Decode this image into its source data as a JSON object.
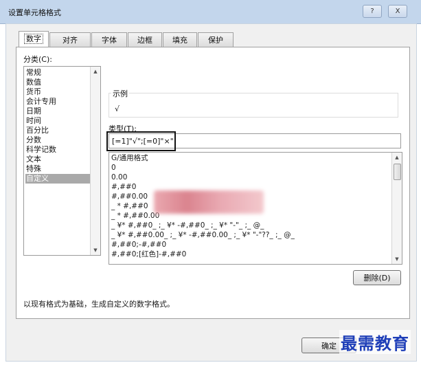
{
  "window": {
    "title": "设置单元格格式",
    "help_btn": "?",
    "close_btn": "X"
  },
  "tabs": [
    {
      "label": "数字",
      "active": true
    },
    {
      "label": "对齐",
      "active": false
    },
    {
      "label": "字体",
      "active": false
    },
    {
      "label": "边框",
      "active": false
    },
    {
      "label": "填充",
      "active": false
    },
    {
      "label": "保护",
      "active": false
    }
  ],
  "category": {
    "label": "分类(C):",
    "items": [
      "常规",
      "数值",
      "货币",
      "会计专用",
      "日期",
      "时间",
      "百分比",
      "分数",
      "科学记数",
      "文本",
      "特殊",
      "自定义"
    ],
    "selected": "自定义"
  },
  "sample": {
    "label": "示例",
    "value": "√"
  },
  "type": {
    "label": "类型(T):",
    "value": "[=1]\"√\";[=0]\"×\"",
    "formats": [
      "G/通用格式",
      "0",
      "0.00",
      "#,##0",
      "#,##0.00",
      "_ * #,##0",
      "_ * #,##0.00",
      "_ ¥* #,##0_ ;_ ¥* -#,##0_ ;_ ¥* \"-\"_ ;_ @_",
      "_ ¥* #,##0.00_ ;_ ¥* -#,##0.00_ ;_ ¥* \"-\"??_ ;_ @_",
      "#,##0;-#,##0",
      "#,##0;[红色]-#,##0"
    ]
  },
  "delete_button": "删除(D)",
  "description": "以现有格式为基础，生成自定义的数字格式。",
  "ok_button": "确定",
  "watermark": "最需教育"
}
